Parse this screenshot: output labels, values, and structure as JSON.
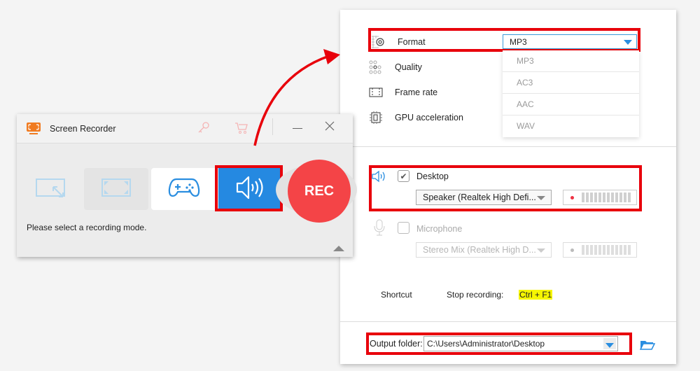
{
  "settings": {
    "rows": [
      {
        "label": "Format",
        "icon": "format-gear-icon"
      },
      {
        "label": "Quality",
        "icon": "quality-dots-icon"
      },
      {
        "label": "Frame rate",
        "icon": "frame-rate-icon"
      },
      {
        "label": "GPU acceleration",
        "icon": "gpu-chip-icon"
      }
    ],
    "format_selected": "MP3",
    "format_options": [
      "MP3",
      "AC3",
      "AAC",
      "WAV"
    ],
    "desktop": {
      "label": "Desktop",
      "checked": true,
      "device": "Speaker (Realtek High Defi..."
    },
    "microphone": {
      "label": "Microphone",
      "checked": false,
      "device": "Stereo Mix (Realtek High D..."
    },
    "shortcut": {
      "label": "Shortcut",
      "action": "Stop recording:",
      "keys": "Ctrl + F1"
    },
    "output": {
      "label": "Output folder:",
      "path": "C:\\Users\\Administrator\\Desktop"
    }
  },
  "recorder": {
    "title": "Screen Recorder",
    "modes": [
      "region-mode",
      "fullscreen-mode",
      "game-mode",
      "audio-mode"
    ],
    "selected_mode": "audio-mode",
    "rec_label": "REC",
    "status": "Please select a recording mode."
  },
  "colors": {
    "accent": "#2a8ee0",
    "highlight": "#e8000b",
    "rec": "#f44447"
  }
}
